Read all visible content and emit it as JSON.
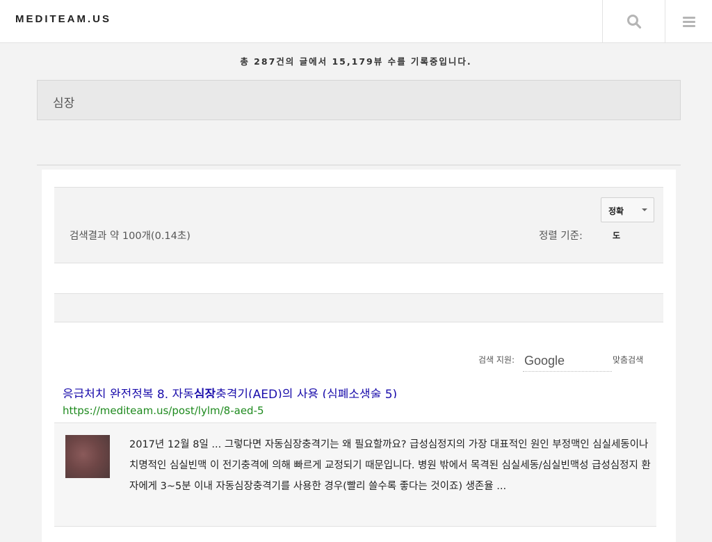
{
  "header": {
    "logo": "MEDITEAM.US",
    "search_icon": "search-icon",
    "menu_icon": "hamburger-menu-icon"
  },
  "stats_text": "총 287건의 글에서 15,179뷰 수를 기록중입니다.",
  "category": "심장",
  "search_results": {
    "count_text": "검색결과 약 100개(0.14초)",
    "sort_label": "정렬 기준:",
    "sort_selected": "정확",
    "sort_overflow": "도",
    "powered_by": "검색 지원:",
    "google_text": "Google",
    "custom_search": "맞춤검색",
    "items": [
      {
        "title_prefix": "응급처치 완전정복 8. 자동",
        "title_highlight": "심장",
        "title_suffix": "충격기(AED)의 사용 (심폐소생술 5)",
        "url": "https://mediteam.us/post/lylm/8-aed-5",
        "snippet": "2017년 12월 8일 ... 그렇다면 자동심장충격기는 왜 필요할까요? 급성심정지의 가장 대표적인 원인 부정맥인 심실세동이나 치명적인 심실빈맥 이 전기충격에 의해 빠르게 교정되기 때문입니다. 병원 밖에서 목격된 심실세동/심실빈맥성 급성심정지 환자에게 3~5분 이내 자동심장충격기를 사용한 경우(빨리 쓸수록 좋다는 것이죠) 생존율 ..."
      }
    ]
  },
  "colors": {
    "link": "#1a0dab",
    "url": "#1e8a1e",
    "background": "#f3f3f3"
  }
}
